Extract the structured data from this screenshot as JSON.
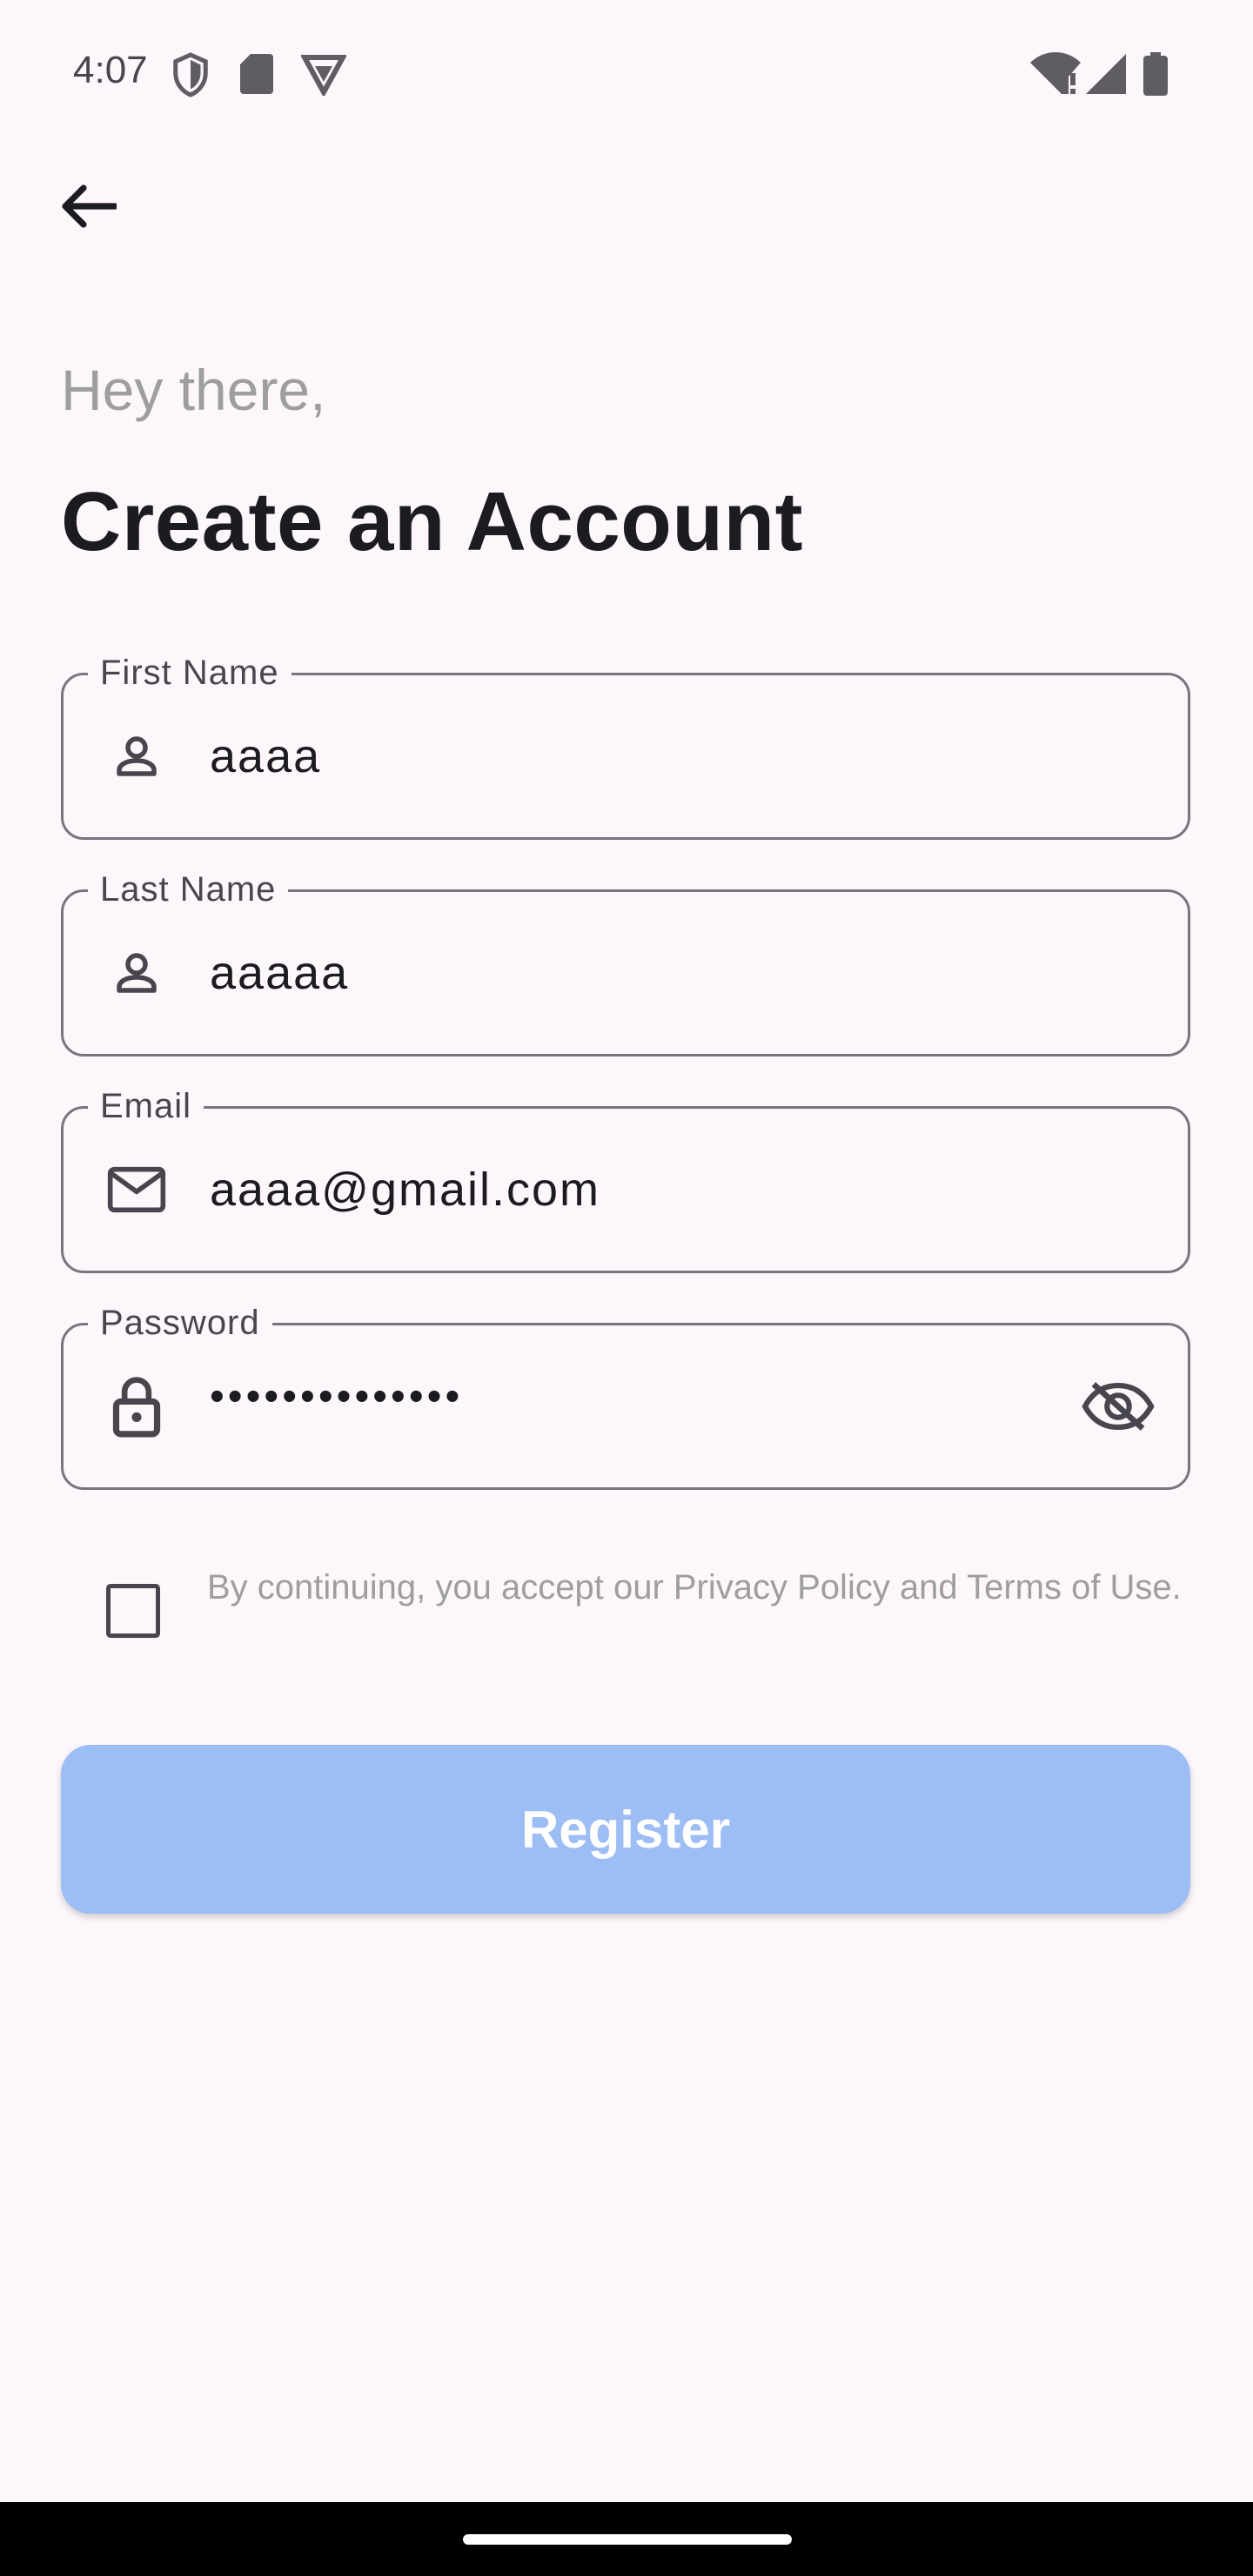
{
  "status_bar": {
    "time": "4:07",
    "left_icons": [
      "shield-icon",
      "sd-card-icon",
      "vpn-icon"
    ],
    "right_icons": [
      "wifi-alert-icon",
      "signal-icon",
      "battery-icon"
    ]
  },
  "header": {
    "back_icon": "arrow-left-icon"
  },
  "greeting": "Hey there,",
  "title": "Create an Account",
  "form": {
    "first_name": {
      "label": "First Name",
      "value": "aaaa",
      "icon": "person-icon"
    },
    "last_name": {
      "label": "Last Name",
      "value": "aaaaa",
      "icon": "person-icon"
    },
    "email": {
      "label": "Email",
      "value": "aaaa@gmail.com",
      "icon": "mail-icon"
    },
    "password": {
      "label": "Password",
      "value": "••••••••••••••",
      "icon": "lock-icon",
      "trailing_icon": "eye-off-icon"
    }
  },
  "terms": {
    "checked": false,
    "text": "By continuing, you accept our Privacy Policy and Terms of Use."
  },
  "register": {
    "label": "Register"
  },
  "colors": {
    "background": "#fdf7fc",
    "button": "#9dbdf5",
    "muted_text": "#9e9e9e",
    "outline": "#79747e"
  }
}
